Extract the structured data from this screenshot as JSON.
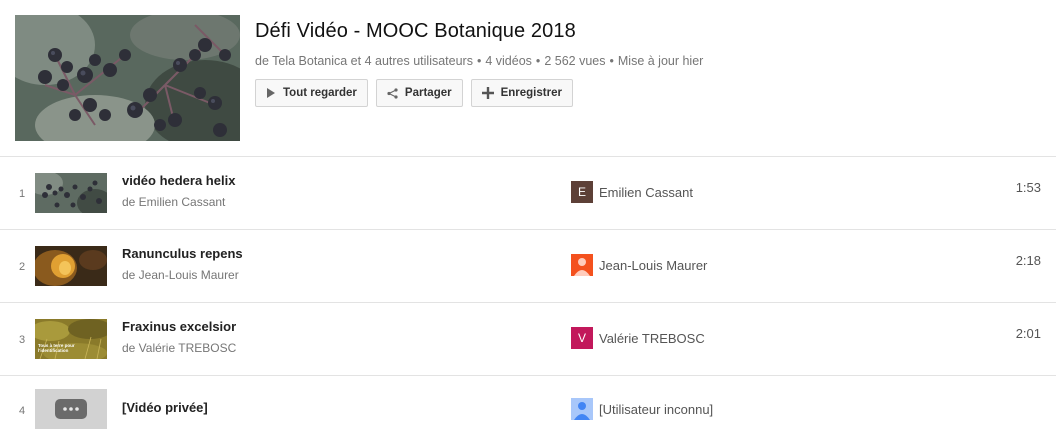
{
  "playlist": {
    "title": "Défi Vidéo - MOOC Botanique 2018",
    "meta": {
      "owner": "de Tela Botanica et 4 autres utilisateurs",
      "count": "4 vidéos",
      "views": "2 562 vues",
      "updated": "Mise à jour hier",
      "separator": "•"
    },
    "actions": {
      "play_all": "Tout regarder",
      "share": "Partager",
      "save": "Enregistrer"
    },
    "icons": {
      "play": "play-icon",
      "share": "share-icon",
      "save": "plus-icon"
    }
  },
  "videos": [
    {
      "index": "1",
      "title": "vidéo hedera helix",
      "by": "de Emilien Cassant",
      "owner": "Emilien Cassant",
      "avatar_letter": "E",
      "avatar_color": "#5d4037",
      "duration": "1:53"
    },
    {
      "index": "2",
      "title": "Ranunculus repens",
      "by": "de Jean-Louis Maurer",
      "owner": "Jean-Louis Maurer",
      "avatar_letter": "",
      "avatar_color": "#f4511e",
      "duration": "2:18"
    },
    {
      "index": "3",
      "title": "Fraxinus excelsior",
      "by": "de Valérie TREBOSC",
      "owner": "Valérie TREBOSC",
      "avatar_letter": "V",
      "avatar_color": "#c2185b",
      "duration": "2:01",
      "thumb_text": "Tous à terre pour l'identification"
    },
    {
      "index": "4",
      "title": "[Vidéo privée]",
      "by": "",
      "owner": "[Utilisateur inconnu]",
      "avatar_letter": "",
      "avatar_color": "#a8c7fa",
      "duration": ""
    }
  ]
}
